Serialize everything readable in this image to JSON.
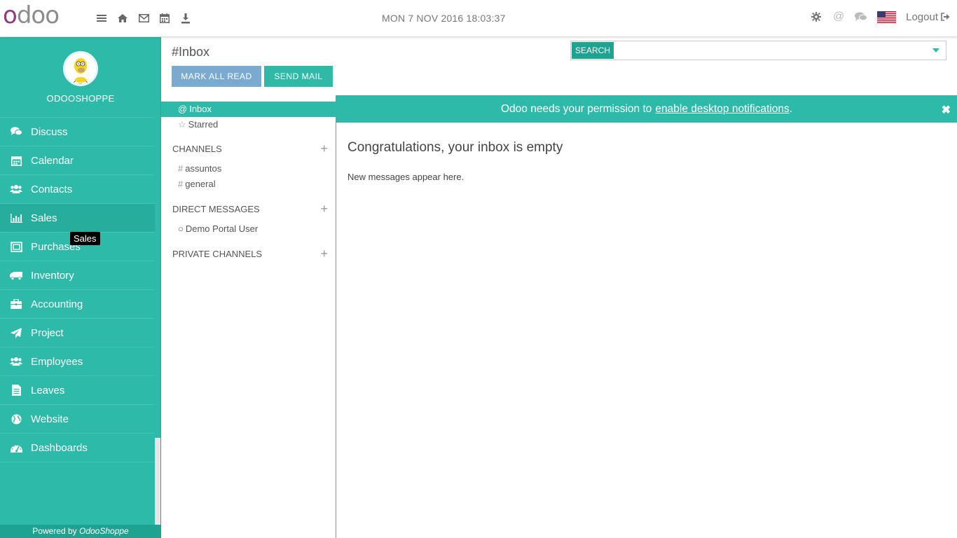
{
  "topbar": {
    "logo_first": "o",
    "logo_rest": "doo",
    "icons": [
      "menu-icon",
      "home-icon",
      "envelope-icon",
      "calendar-icon",
      "download-icon"
    ],
    "clock": "MON 7 NOV 2016 18:03:37",
    "right_icons": [
      "gear-icon",
      "at-icon",
      "comments-icon",
      "us-flag-icon"
    ],
    "logout_label": "Logout"
  },
  "sidebar": {
    "company": "ODOOSHOPPE",
    "items": [
      {
        "label": "Discuss",
        "icon": "comments-icon"
      },
      {
        "label": "Calendar",
        "icon": "calendar-icon"
      },
      {
        "label": "Contacts",
        "icon": "users-icon"
      },
      {
        "label": "Sales",
        "icon": "bar-chart-icon"
      },
      {
        "label": "Purchases",
        "icon": "purchase-icon"
      },
      {
        "label": "Inventory",
        "icon": "truck-icon"
      },
      {
        "label": "Accounting",
        "icon": "briefcase-icon"
      },
      {
        "label": "Project",
        "icon": "paper-plane-icon"
      },
      {
        "label": "Employees",
        "icon": "users-icon"
      },
      {
        "label": "Leaves",
        "icon": "file-icon"
      },
      {
        "label": "Website",
        "icon": "globe-icon"
      },
      {
        "label": "Dashboards",
        "icon": "dashboard-icon"
      }
    ],
    "tooltip": "Sales",
    "powered_prefix": "Powered by ",
    "powered_brand": "OdooShoppe"
  },
  "control_panel": {
    "title": "#Inbox",
    "mark_all_read": "MARK ALL READ",
    "send_mail": "SEND MAIL",
    "search_tag": "SEARCH",
    "search_value": ""
  },
  "discuss": {
    "inbox": "Inbox",
    "starred": "Starred",
    "channels_header": "CHANNELS",
    "channels": [
      "assuntos",
      "general"
    ],
    "dm_header": "DIRECT MESSAGES",
    "dms": [
      "Demo Portal User"
    ],
    "private_header": "PRIVATE CHANNELS"
  },
  "notification": {
    "text": "Odoo needs your permission to",
    "link": "enable desktop notifications",
    "suffix": "."
  },
  "main": {
    "empty_title": "Congratulations, your inbox is empty",
    "empty_sub": "New messages appear here."
  },
  "colors": {
    "accent": "#2ebaa8",
    "mark_button": "#7aaad0",
    "logo_purple": "#8f3a84"
  }
}
